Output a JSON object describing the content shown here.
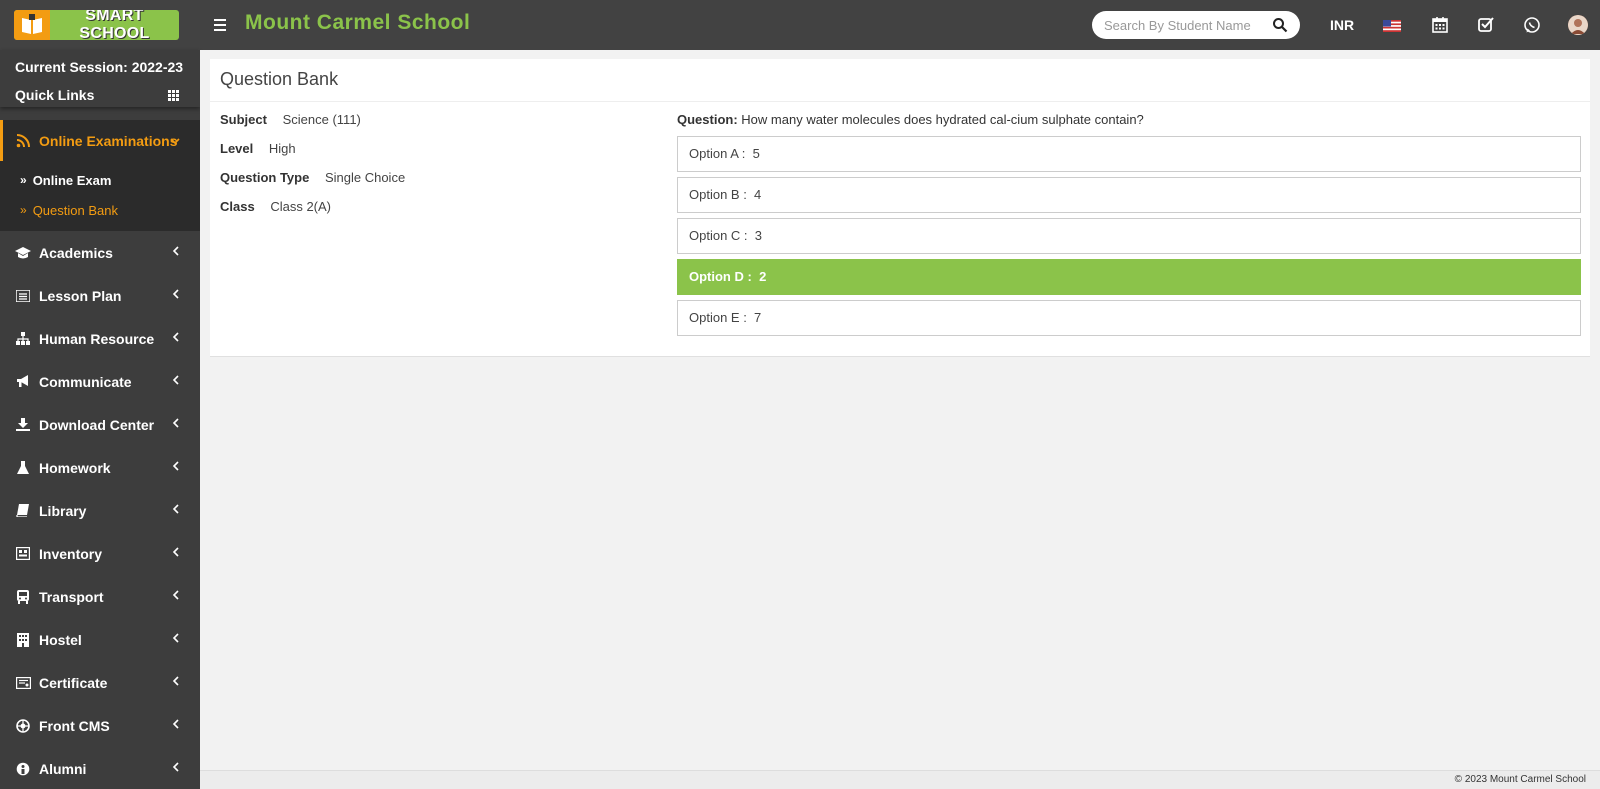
{
  "header": {
    "logo_text": "SMART SCHOOL",
    "school_name": "Mount Carmel School",
    "search": {
      "placeholder": "Search By Student Name"
    },
    "currency": "INR"
  },
  "sidebar": {
    "session": "Current Session: 2022-23",
    "quick_links": "Quick Links",
    "active_menu": {
      "label": "Online Examinations",
      "icon": "rss-icon"
    },
    "submenu": [
      {
        "label": "Online Exam"
      },
      {
        "label": "Question Bank"
      }
    ],
    "items": [
      {
        "label": "Academics",
        "icon": "graduation-cap-icon"
      },
      {
        "label": "Lesson Plan",
        "icon": "list-icon"
      },
      {
        "label": "Human Resource",
        "icon": "sitemap-icon"
      },
      {
        "label": "Communicate",
        "icon": "bullhorn-icon"
      },
      {
        "label": "Download Center",
        "icon": "download-icon"
      },
      {
        "label": "Homework",
        "icon": "flask-icon"
      },
      {
        "label": "Library",
        "icon": "book-icon"
      },
      {
        "label": "Inventory",
        "icon": "inventory-icon"
      },
      {
        "label": "Transport",
        "icon": "bus-icon"
      },
      {
        "label": "Hostel",
        "icon": "building-icon"
      },
      {
        "label": "Certificate",
        "icon": "certificate-icon"
      },
      {
        "label": "Front CMS",
        "icon": "cms-icon"
      },
      {
        "label": "Alumni",
        "icon": "alumni-icon"
      }
    ]
  },
  "main": {
    "title": "Question Bank",
    "info": [
      {
        "label": "Subject",
        "value": "Science (111)"
      },
      {
        "label": "Level",
        "value": "High"
      },
      {
        "label": "Question Type",
        "value": "Single Choice"
      },
      {
        "label": "Class",
        "value": "Class 2(A)"
      }
    ],
    "question_label": "Question:",
    "question_text": "How many water molecules does hydrated cal-cium sulphate contain?",
    "options": [
      {
        "label": "Option A :",
        "value": "5"
      },
      {
        "label": "Option B :",
        "value": "4"
      },
      {
        "label": "Option C :",
        "value": "3"
      },
      {
        "label": "Option D :",
        "value": "2"
      },
      {
        "label": "Option E :",
        "value": "7"
      }
    ],
    "correct_option": "Option D",
    "correct_color": "#8bc34a"
  },
  "footer": {
    "text": "© 2023 Mount Carmel School"
  },
  "colors": {
    "accent_green": "#8bc34a",
    "accent_orange": "#f39c12",
    "header_bg": "#424242",
    "sidebar_bg": "#3d3d3d"
  }
}
